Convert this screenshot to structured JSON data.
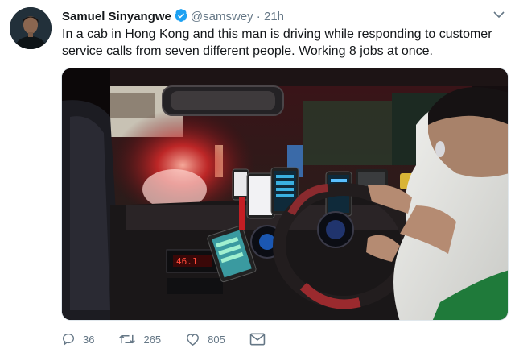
{
  "author": {
    "name": "Samuel Sinyangwe",
    "handle": "@samswey",
    "time": "21h",
    "verified": true,
    "avatar_icon": "profile-photo"
  },
  "tweet": {
    "text": "In a cab in Hong Kong and this man is driving while responding to customer service calls from seven different people. Working 8 jobs at once."
  },
  "media": {
    "description_icon": "photo-taxi-driver-phones"
  },
  "actions": {
    "reply_count": "36",
    "retweet_count": "265",
    "like_count": "805"
  },
  "colors": {
    "text": "#14171a",
    "secondary": "#657786",
    "verified": "#1da1f2",
    "border": "#e1e8ed"
  }
}
